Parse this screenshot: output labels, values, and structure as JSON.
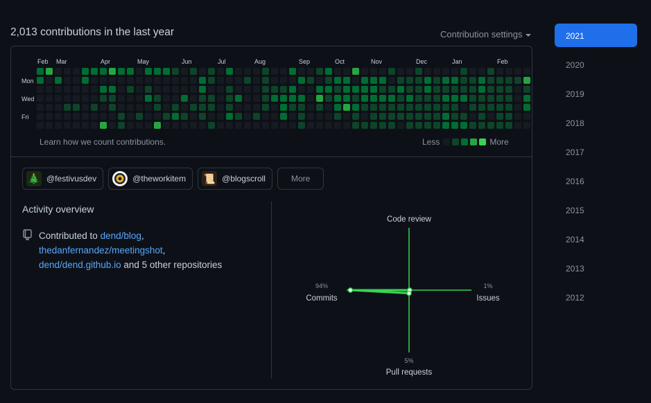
{
  "heading": "2,013 contributions in the last year",
  "contribution_settings": "Contribution settings",
  "calendar": {
    "months": [
      "Feb",
      "Mar",
      "Apr",
      "May",
      "Jun",
      "Jul",
      "Aug",
      "Sep",
      "Oct",
      "Nov",
      "Dec",
      "Jan",
      "Feb"
    ],
    "day_labels": [
      "Mon",
      "Wed",
      "Fri"
    ],
    "levels": [
      "2300022232202221010102000100200120030001001000010010000",
      "2020020000000000002100010100021012202220111212211211113",
      "0000000220101000002001000111200221222211211211111211101",
      "0000000110002100201101200122220312212222121112221111102",
      "0001101010000101011101000102110102321111111111101111102",
      "0000000001010012101002101002010001010111111112110101100",
      "0000000301000300000100000000010000011111011112221111100"
    ],
    "colors": [
      "#161b22",
      "#0e4429",
      "#006d32",
      "#26a641",
      "#39d353"
    ],
    "learn_link": "Learn how we count contributions.",
    "legend_less": "Less",
    "legend_more": "More"
  },
  "organizations": [
    {
      "name": "@festivusdev",
      "icon": "tree-icon"
    },
    {
      "name": "@theworkitem",
      "icon": "badge-icon"
    },
    {
      "name": "@blogscroll",
      "icon": "scroll-icon"
    }
  ],
  "more_button": "More",
  "activity": {
    "title": "Activity overview",
    "contributed_to": "Contributed to",
    "repo1": "dend/blog",
    "repo2": "thedanfernandez/meetingshot",
    "repo3": "dend/dend.github.io",
    "others": "and 5 other repositories",
    "radar": {
      "code_review_label": "Code review",
      "commits_label": "Commits",
      "commits_pct": "94%",
      "issues_label": "Issues",
      "issues_pct": "1%",
      "pull_requests_label": "Pull requests",
      "pull_requests_pct": "5%",
      "commits_value": 94,
      "issues_value": 1,
      "pull_requests_value": 5,
      "code_review_value": 0
    }
  },
  "years": [
    "2021",
    "2020",
    "2019",
    "2018",
    "2017",
    "2016",
    "2015",
    "2014",
    "2013",
    "2012"
  ],
  "active_year": "2021",
  "colors": {
    "background": "#0d1117",
    "border": "#30363d",
    "link": "#58a6ff",
    "active_year_bg": "#1f6feb",
    "radar_line": "#2ea043"
  }
}
